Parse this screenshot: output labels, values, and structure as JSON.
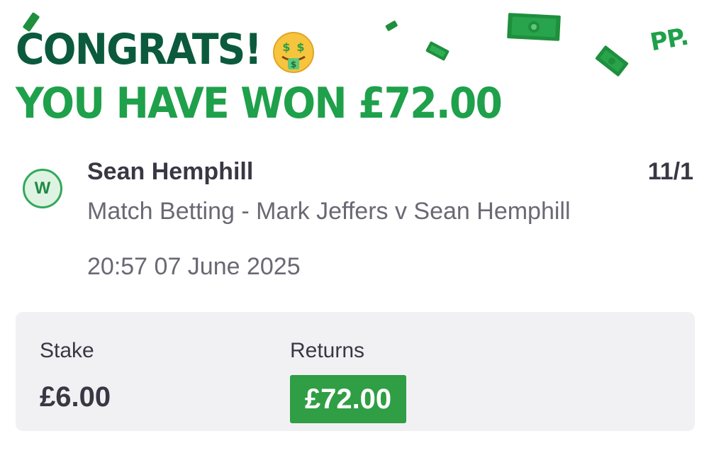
{
  "header": {
    "line1": "CONGRATS!",
    "line2": "YOU HAVE WON £72.00",
    "emoji": "money-mouth-face-icon",
    "brand_logo_text": "PP."
  },
  "bet": {
    "result_badge": "W",
    "selection": "Sean Hemphill",
    "odds": "11/1",
    "market": "Match Betting - Mark Jeffers v Sean Hemphill",
    "placed_at": "20:57 07 June 2025"
  },
  "summary": {
    "stake_label": "Stake",
    "stake_value": "£6.00",
    "returns_label": "Returns",
    "returns_value": "£72.00"
  },
  "colors": {
    "dark_green": "#0b5a3e",
    "bright_green": "#1fa04a",
    "returns_green": "#2f9e44",
    "panel_bg": "#f1f1f4",
    "text_dark": "#3a3744",
    "text_muted": "#6a6873"
  }
}
